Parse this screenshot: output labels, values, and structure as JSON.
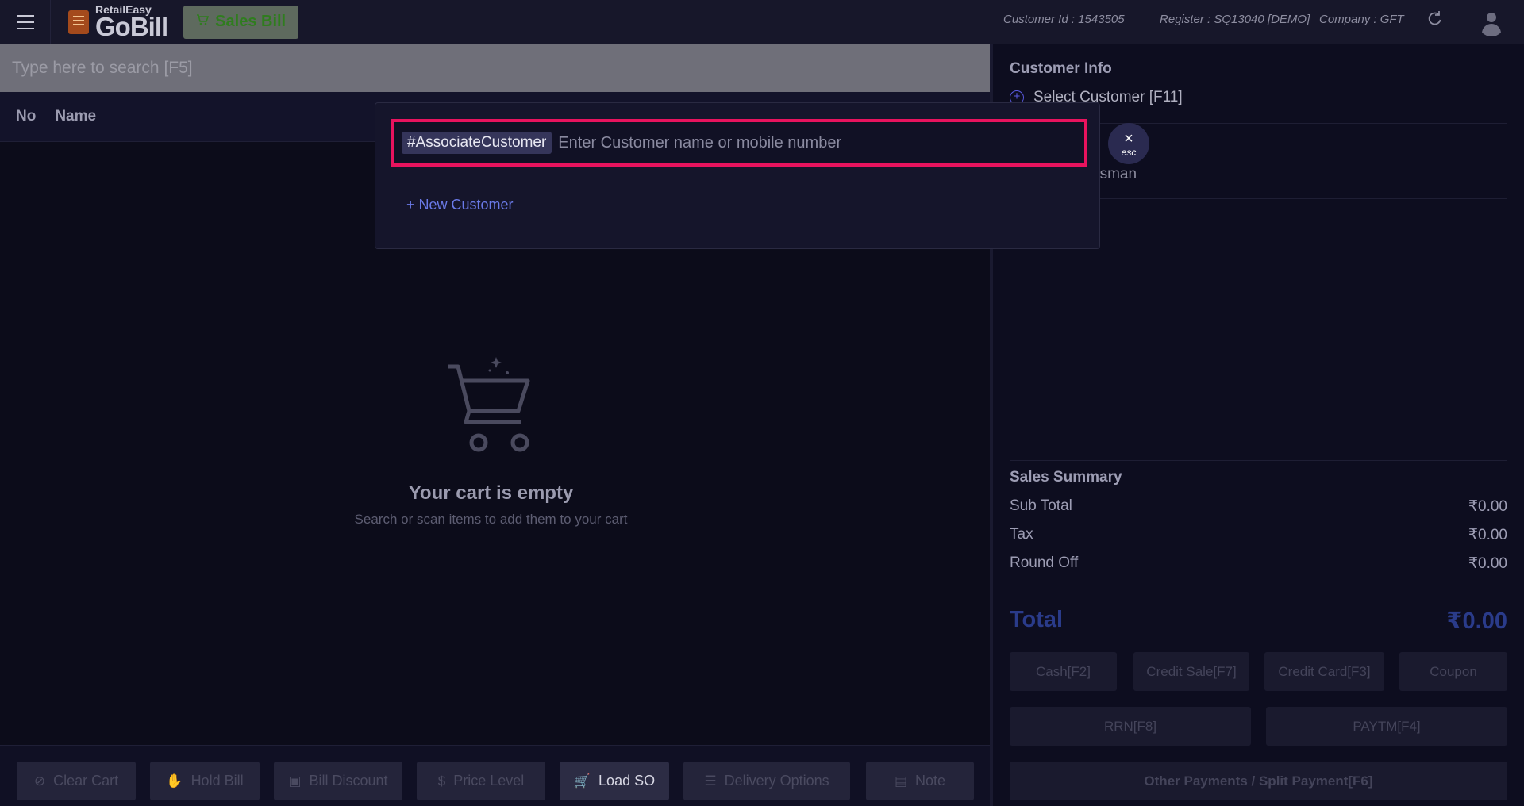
{
  "header": {
    "logo_small": "RetailEasy",
    "logo_big": "GoBill",
    "sales_bill_label": "Sales Bill",
    "customer_id": "Customer Id : 1543505",
    "register": "Register : SQ13040 [DEMO]",
    "company": "Company : GFT"
  },
  "search": {
    "placeholder": "Type here to search [F5]"
  },
  "list": {
    "col_no": "No",
    "col_name": "Name"
  },
  "cart": {
    "empty_title": "Your cart is empty",
    "empty_subtitle": "Search or scan items to add them to your cart"
  },
  "bottom_actions": {
    "clear_cart": "Clear Cart",
    "hold_bill": "Hold Bill",
    "bill_discount": "Bill Discount",
    "price_level": "Price Level",
    "load_so": "Load SO",
    "delivery_options": "Delivery Options",
    "note": "Note"
  },
  "customer_info": {
    "title": "Customer Info",
    "select_customer": "Select Customer [F11]",
    "salesman_partial": "esman"
  },
  "sales_summary": {
    "title": "Sales Summary",
    "sub_total_label": "Sub Total",
    "sub_total_value": "₹0.00",
    "tax_label": "Tax",
    "tax_value": "₹0.00",
    "round_off_label": "Round Off",
    "round_off_value": "₹0.00",
    "total_label": "Total",
    "total_value": "₹0.00"
  },
  "payments": {
    "cash": "Cash[F2]",
    "credit_sale": "Credit Sale[F7]",
    "credit_card": "Credit Card[F3]",
    "coupon": "Coupon",
    "rrn": "RRN[F8]",
    "paytm": "PAYTM[F4]",
    "other": "Other Payments / Split Payment[F6]"
  },
  "modal": {
    "tag": "#AssociateCustomer",
    "placeholder": "Enter Customer name or mobile number",
    "new_customer": "+ New Customer",
    "esc_icon": "×",
    "esc_label": "esc"
  },
  "colors": {
    "accent_border": "#e8135e",
    "link": "#6a7ae8",
    "total": "#2a3b8a"
  }
}
